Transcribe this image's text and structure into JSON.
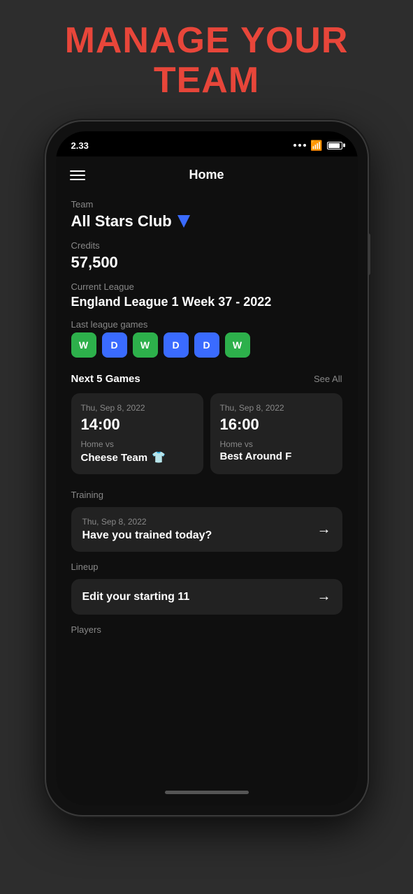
{
  "page": {
    "title_line1": "MANAGE YOUR",
    "title_line2": "TEAM"
  },
  "status_bar": {
    "time": "2.33",
    "wifi": "wifi",
    "battery": "battery"
  },
  "nav": {
    "title": "Home",
    "hamburger_label": "menu"
  },
  "team": {
    "label": "Team",
    "name": "All Stars Club"
  },
  "credits": {
    "label": "Credits",
    "value": "57,500"
  },
  "league": {
    "label": "Current League",
    "name": "England League 1 Week 37 - 2022"
  },
  "last_games": {
    "label": "Last league games",
    "results": [
      {
        "result": "W",
        "type": "win"
      },
      {
        "result": "D",
        "type": "draw"
      },
      {
        "result": "W",
        "type": "win"
      },
      {
        "result": "D",
        "type": "draw"
      },
      {
        "result": "D",
        "type": "draw"
      },
      {
        "result": "W",
        "type": "win"
      }
    ]
  },
  "next_games": {
    "label": "Next 5 Games",
    "see_all": "See All",
    "games": [
      {
        "date": "Thu, Sep 8, 2022",
        "time": "14:00",
        "venue": "Home vs",
        "opponent": "Cheese Team",
        "has_shirt": true
      },
      {
        "date": "Thu, Sep 8, 2022",
        "time": "16:00",
        "venue": "Home vs",
        "opponent": "Best Around F",
        "has_shirt": false
      }
    ]
  },
  "training": {
    "label": "Training",
    "card": {
      "date": "Thu, Sep 8, 2022",
      "text": "Have you trained today?"
    }
  },
  "lineup": {
    "label": "Lineup",
    "card": {
      "text": "Edit your starting 11"
    }
  },
  "players": {
    "label": "Players"
  }
}
